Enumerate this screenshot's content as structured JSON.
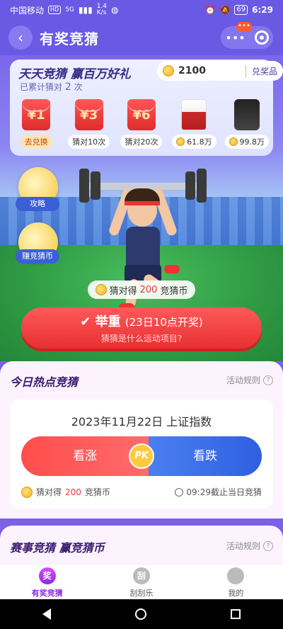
{
  "status_bar": {
    "carrier": "中国移动",
    "hd": "HD",
    "network": "5G",
    "speed": "1.4\nK/s",
    "battery": "69",
    "time": "6:29"
  },
  "header": {
    "title": "有奖竞猜"
  },
  "prize_card": {
    "headline": "天天竞猜 赢百万好礼",
    "sub_prefix": "已累计猜对",
    "sub_count": "2",
    "sub_suffix": "次",
    "coins": "2100",
    "redeem_label": "兑奖品",
    "prizes": [
      {
        "value": "¥1",
        "label": "去兑换"
      },
      {
        "value": "¥3",
        "label": "猜对10次"
      },
      {
        "value": "¥6",
        "label": "猜对20次"
      },
      {
        "image": "liquor-icon",
        "label": "61.8万"
      },
      {
        "image": "phone-icon",
        "label": "99.8万"
      }
    ]
  },
  "scene": {
    "strategy_label": "攻略",
    "earn_label": "赚竞猜币",
    "reward_prefix": "猜对得",
    "reward_value": "200",
    "reward_suffix": "竞猜币",
    "guess_button_main": "举重",
    "guess_button_time": "(23日10点开奖)",
    "guess_button_sub": "猜猜是什么运动项目?"
  },
  "hot_section": {
    "title": "今日热点竞猜",
    "rules_label": "活动规则",
    "question": "2023年11月22日 上证指数",
    "up_label": "看涨",
    "down_label": "看跌",
    "pk_label": "PK",
    "reward_prefix": "猜对得",
    "reward_value": "200",
    "reward_suffix": "竞猜币",
    "deadline": "09:29截止当日竞猜"
  },
  "event_section": {
    "title": "赛事竞猜 赢竞猜币",
    "rules_label": "活动规则"
  },
  "tabbar": {
    "tabs": [
      {
        "icon": "奖",
        "label": "有奖竞猜"
      },
      {
        "icon": "刮",
        "label": "刮刮乐"
      },
      {
        "icon": "",
        "label": "我的"
      }
    ]
  },
  "colors": {
    "brand_purple": "#6a59e3",
    "accent_red": "#e63030",
    "accent_blue": "#2f5fe0"
  }
}
